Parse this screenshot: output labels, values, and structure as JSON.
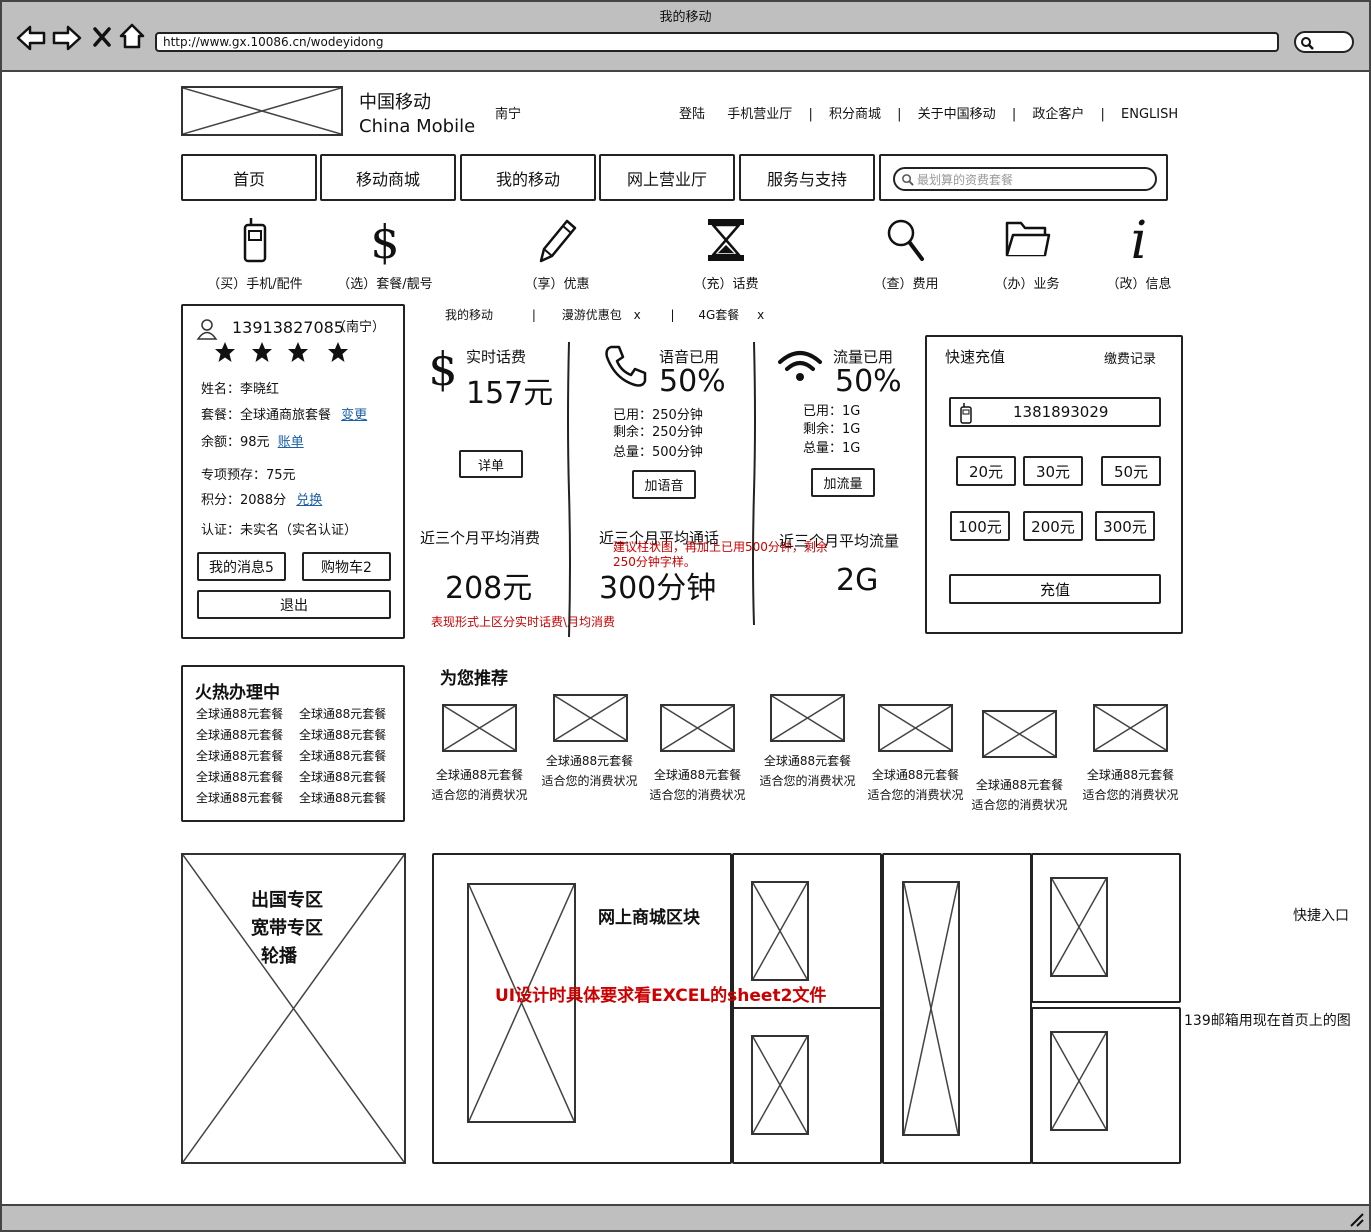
{
  "browser": {
    "title": "我的移动",
    "url": "http://www.gx.10086.cn/wodeyidong",
    "nav_icons": [
      "back-arrow-icon",
      "forward-arrow-icon",
      "close-icon",
      "home-icon"
    ]
  },
  "header": {
    "brand_cn": "中国移动",
    "brand_en": "China Mobile",
    "city": "南宁",
    "links": [
      "登陆",
      "手机营业厅",
      "积分商城",
      "关于中国移动",
      "政企客户",
      "ENGLISH"
    ]
  },
  "nav": {
    "tabs": [
      "首页",
      "移动商城",
      "我的移动",
      "网上营业厅",
      "服务与支持"
    ],
    "search_placeholder": "最划算的资费套餐"
  },
  "quick_icons": [
    {
      "icon": "phone-icon",
      "label": "（买）手机/配件"
    },
    {
      "icon": "dollar-icon",
      "label": "（选）套餐/靓号"
    },
    {
      "icon": "pencil-icon",
      "label": "（享）优惠"
    },
    {
      "icon": "hourglass-icon",
      "label": "（充）话费"
    },
    {
      "icon": "magnifier-icon",
      "label": "（查）费用"
    },
    {
      "icon": "folder-icon",
      "label": "（办）业务"
    },
    {
      "icon": "info-icon",
      "label": "（改）信息"
    }
  ],
  "user": {
    "phone": "13913827085",
    "city": "（南宁）",
    "stars": 4,
    "name": "姓名：李晓红",
    "plan": "套餐：全球通商旅套餐",
    "plan_link": "变更",
    "balance": "余额：98元",
    "balance_link": "账单",
    "deposit": "专项预存：75元",
    "points": "积分：2088分",
    "points_link": "兑换",
    "auth": "认证：未实名（实名认证）",
    "msg_btn": "我的消息5",
    "cart_btn": "购物车2",
    "logout_btn": "退出"
  },
  "tabs": [
    {
      "label": "我的移动",
      "closable": false
    },
    {
      "label": "漫游优惠包",
      "closable": true
    },
    {
      "label": "4G套餐",
      "closable": true
    }
  ],
  "tab_close": "x",
  "tab_sep": "|",
  "usage": {
    "fee": {
      "title": "实时话费",
      "value": "157元",
      "button": "详单",
      "avg_label": "近三个月平均消费",
      "avg_value": "208元"
    },
    "voice": {
      "title": "语音已用",
      "value": "50%",
      "used": "已用：250分钟",
      "left": "剩余：250分钟",
      "total": "总量：500分钟",
      "button": "加语音",
      "avg_label": "近三个月平均通话",
      "avg_value": "300分钟"
    },
    "data": {
      "title": "流量已用",
      "value": "50%",
      "used": "已用：1G",
      "left": "剩余：1G",
      "total": "总量：1G",
      "button": "加流量",
      "avg_label": "近三个月平均流量",
      "avg_value": "2G"
    },
    "note_voice": "建议柱状图，再加上已用500分钟，剩余250分钟字样。",
    "note_fee": "表现形式上区分实时话费\\月均消费"
  },
  "recharge": {
    "title": "快速充值",
    "history": "缴费记录",
    "phone": "1381893029",
    "amounts": [
      "20元",
      "30元",
      "50元",
      "100元",
      "200元",
      "300元"
    ],
    "button": "充值"
  },
  "hot": {
    "title": "火热办理中",
    "items": [
      "全球通88元套餐",
      "全球通88元套餐",
      "全球通88元套餐",
      "全球通88元套餐",
      "全球通88元套餐",
      "全球通88元套餐",
      "全球通88元套餐",
      "全球通88元套餐",
      "全球通88元套餐",
      "全球通88元套餐"
    ]
  },
  "recommend": {
    "title": "为您推荐",
    "items": [
      {
        "line1": "全球通88元套餐",
        "line2": "适合您的消费状况"
      },
      {
        "line1": "全球通88元套餐",
        "line2": "适合您的消费状况"
      },
      {
        "line1": "全球通88元套餐",
        "line2": "适合您的消费状况"
      },
      {
        "line1": "全球通88元套餐",
        "line2": "适合您的消费状况"
      },
      {
        "line1": "全球通88元套餐",
        "line2": "适合您的消费状况"
      },
      {
        "line1": "全球通88元套餐",
        "line2": "适合您的消费状况"
      },
      {
        "line1": "全球通88元套餐",
        "line2": "适合您的消费状况"
      }
    ]
  },
  "bottom": {
    "banner_lines": [
      "出国专区",
      "宽带专区",
      "轮播"
    ],
    "mall_title": "网上商城区块",
    "mall_note": "UI设计时具体要求看EXCEL的sheet2文件",
    "quick_entry": "快捷入口",
    "mail_note": "139邮箱用现在首页上的图"
  }
}
